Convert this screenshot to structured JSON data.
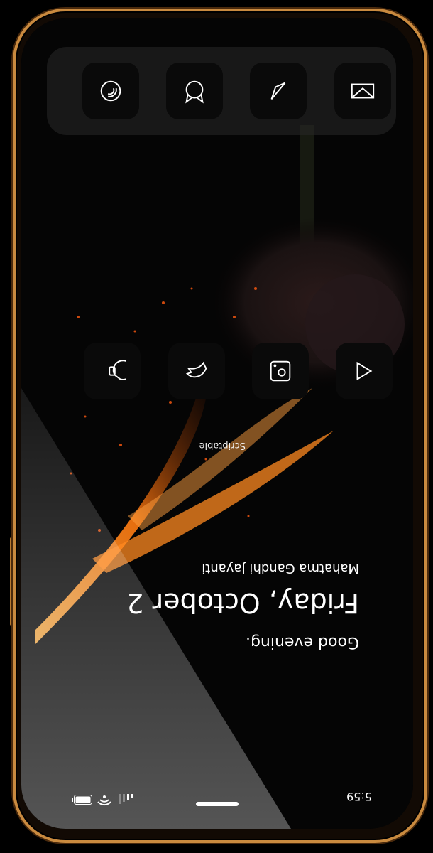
{
  "status_bar": {
    "time": "5:59"
  },
  "widget": {
    "greeting": "Good evening.",
    "date": "Friday, October 2",
    "event": "Mahatma Gandhi Jayanti"
  },
  "home_row": {
    "label": "Scriptable",
    "icons": [
      "shortcut-icon",
      "bird-icon",
      "camera-icon",
      "play-icon"
    ]
  },
  "dock": {
    "icons": [
      "podcast-icon",
      "cat-icon",
      "compass-icon",
      "photos-icon"
    ]
  },
  "colors": {
    "frame_gold": "#c98a3f",
    "flame_orange": "#ff7a10",
    "background": "#050505"
  }
}
